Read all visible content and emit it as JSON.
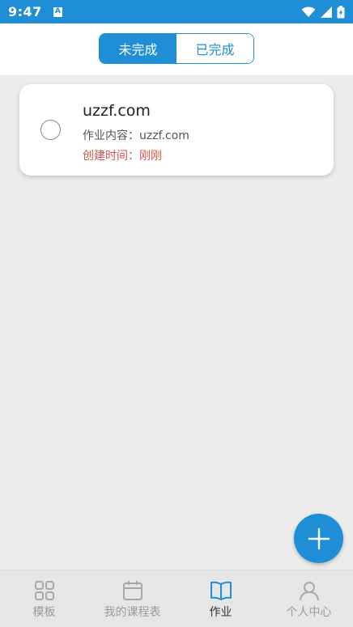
{
  "status_bar": {
    "time": "9:47",
    "notification_icon": "a-icon",
    "icons": [
      "wifi-icon",
      "signal-icon",
      "battery-charging-icon"
    ]
  },
  "segmented": {
    "tabs": [
      {
        "label": "未完成",
        "active": true
      },
      {
        "label": "已完成",
        "active": false
      }
    ]
  },
  "homework_list": [
    {
      "title": "uzzf.com",
      "content": "作业内容：uzzf.com",
      "created": "创建时间：刚刚",
      "completed": false
    }
  ],
  "fab": {
    "icon": "plus-icon"
  },
  "bottom_nav": {
    "items": [
      {
        "label": "模板",
        "icon": "grid-icon",
        "active": false
      },
      {
        "label": "我的课程表",
        "icon": "calendar-icon",
        "active": false
      },
      {
        "label": "作业",
        "icon": "book-icon",
        "active": true
      },
      {
        "label": "个人中心",
        "icon": "person-icon",
        "active": false
      }
    ]
  },
  "colors": {
    "primary": "#1e8fd6",
    "created_time_text": "#d9534f",
    "background": "#ececec"
  }
}
